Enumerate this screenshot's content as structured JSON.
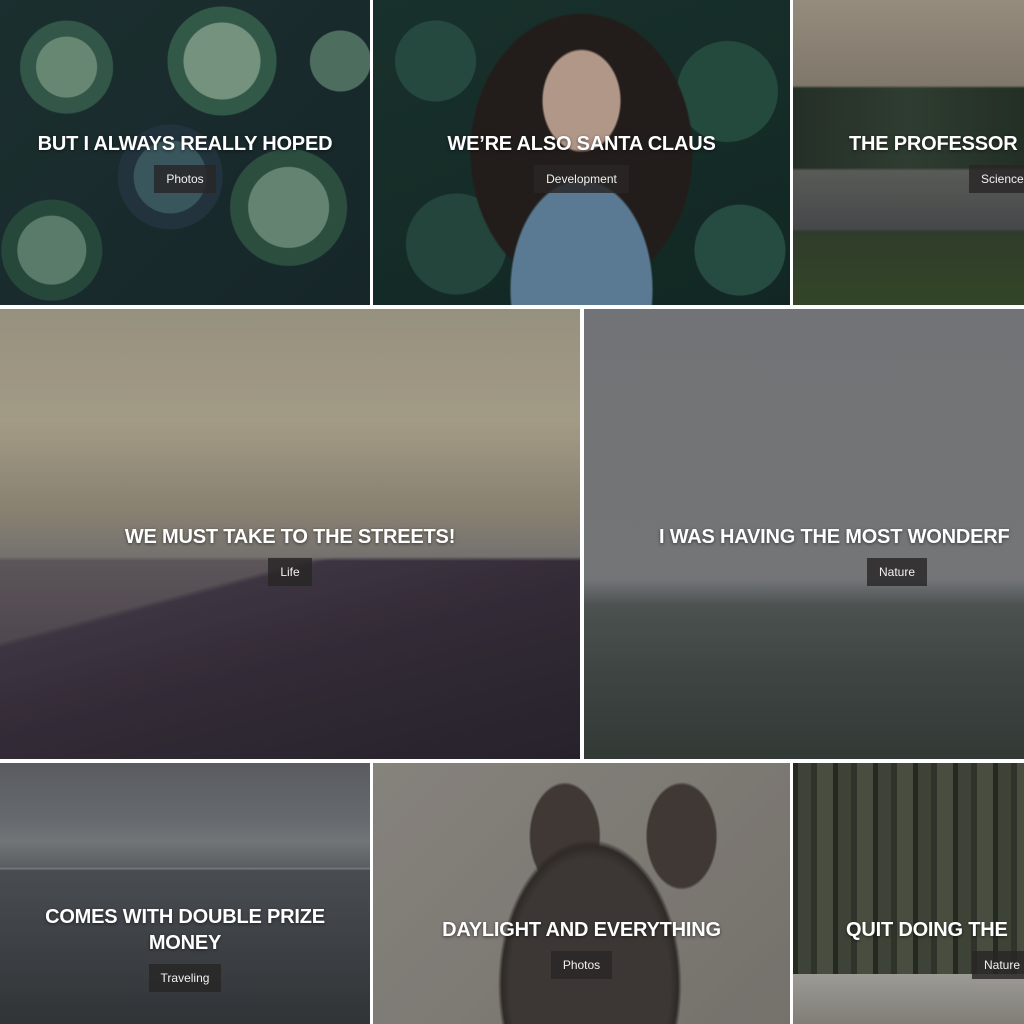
{
  "tiles": [
    {
      "title": "BUT I ALWAYS REALLY HOPED",
      "category": "Photos"
    },
    {
      "title": "WE’RE ALSO SANTA CLAUS",
      "category": "Development"
    },
    {
      "title": "THE PROFESSOR",
      "category": "Science"
    },
    {
      "title": "WE MUST TAKE TO THE STREETS!",
      "category": "Life"
    },
    {
      "title": "I WAS HAVING THE MOST WONDERF",
      "category": "Nature"
    },
    {
      "title": "COMES WITH DOUBLE PRIZE MONEY",
      "category": "Traveling"
    },
    {
      "title": "DAYLIGHT AND EVERYTHING",
      "category": "Photos"
    },
    {
      "title": "QUIT DOING THE",
      "category": "Nature"
    }
  ]
}
